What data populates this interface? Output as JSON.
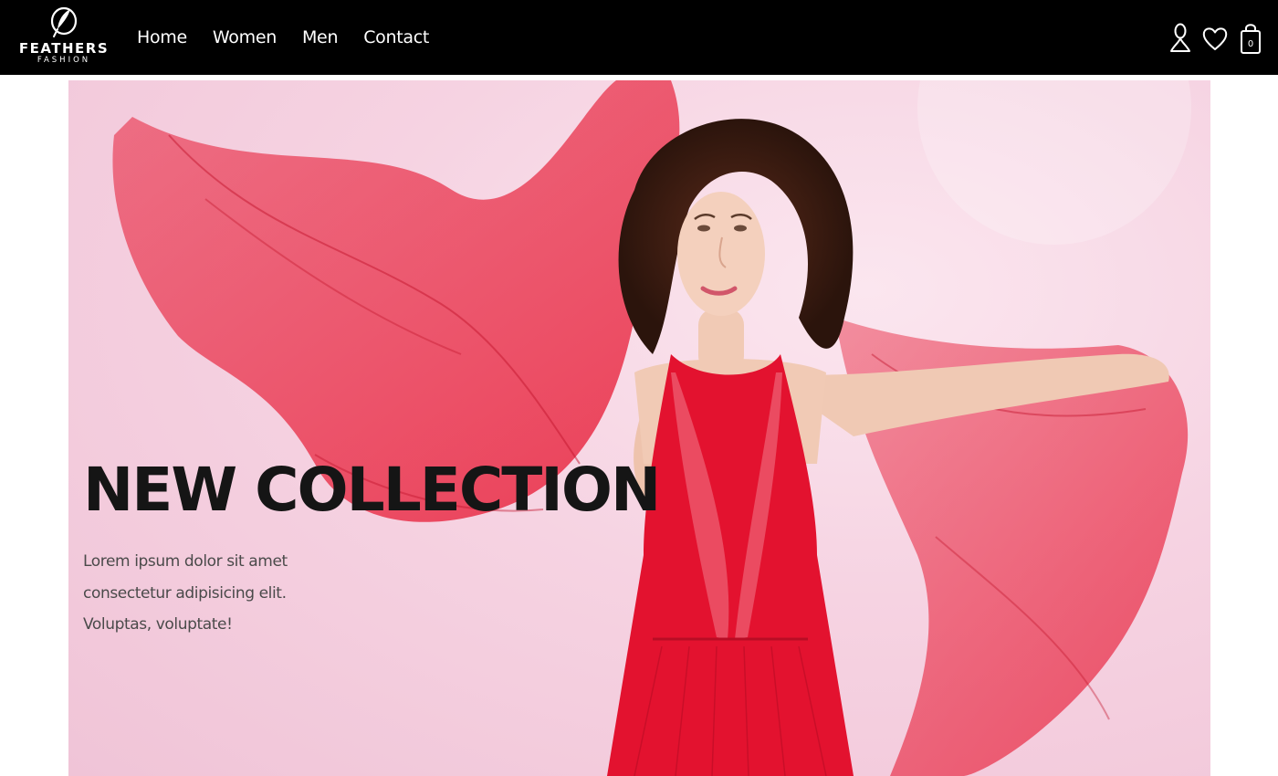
{
  "brand": {
    "name": "FEATHERS",
    "tagline": "FASHION",
    "logo_icon": "feather-icon"
  },
  "nav": {
    "links": [
      "Home",
      "Women",
      "Men",
      "Contact"
    ],
    "icons": [
      "user-icon",
      "heart-icon",
      "shopping-bag-icon"
    ],
    "cart_count": "0"
  },
  "hero": {
    "title": "NEW COLLECTION",
    "description": "Lorem ipsum dolor sit amet consectetur adipisicing elit. Voluptas, voluptate!",
    "image": "woman-in-red-dress-with-flowing-scarf"
  },
  "colors": {
    "navbar_bg": "#000000",
    "hero_bg": "#f6d3e2",
    "accent_red": "#e8233d",
    "title_text": "#151515"
  }
}
